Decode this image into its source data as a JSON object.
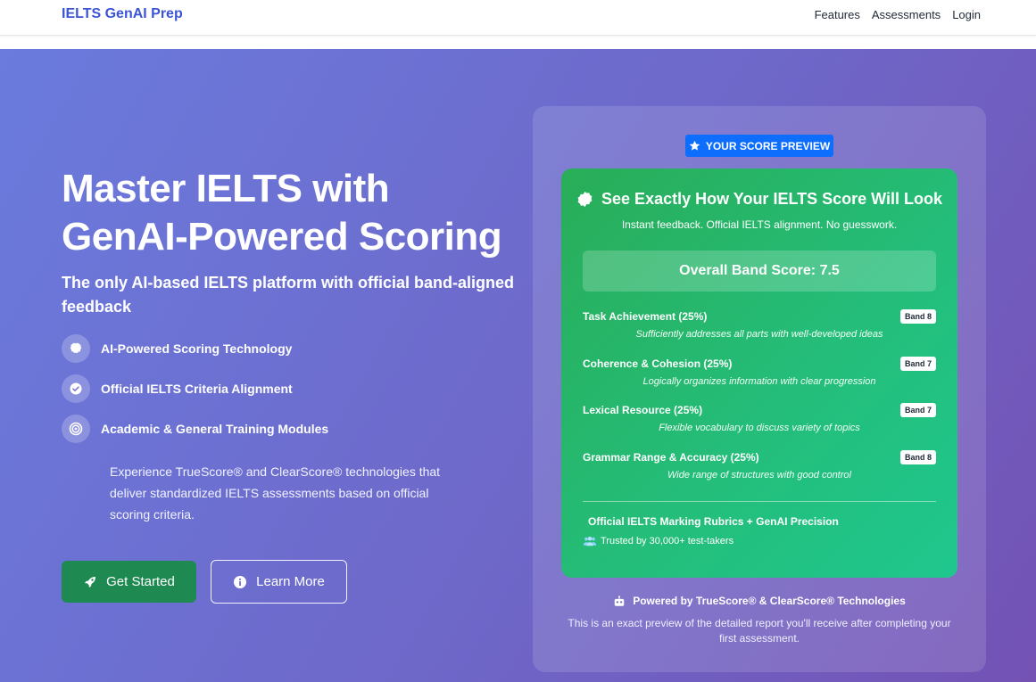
{
  "nav": {
    "brand": "IELTS GenAI Prep",
    "links": [
      "Features",
      "Assessments",
      "Login"
    ]
  },
  "hero": {
    "title": "Master IELTS with GenAI-Powered Scoring",
    "subtitle": "The only AI-based IELTS platform with official band-aligned feedback",
    "features": [
      {
        "icon": "brain-icon",
        "label": "AI-Powered Scoring Technology"
      },
      {
        "icon": "check-circle-icon",
        "label": "Official IELTS Criteria Alignment"
      },
      {
        "icon": "target-icon",
        "label": "Academic & General Training Modules"
      }
    ],
    "description": "Experience TrueScore® and ClearScore® technologies that deliver standardized IELTS assessments based on official scoring criteria.",
    "primary_button": "Get Started",
    "secondary_button": "Learn More"
  },
  "preview": {
    "badge": "YOUR SCORE PREVIEW",
    "card_title": "See Exactly How Your IELTS Score Will Look",
    "card_subtitle": "Instant feedback. Official IELTS alignment. No guesswork.",
    "overall": "Overall Band Score: 7.5",
    "criteria": [
      {
        "name": "Task Achievement (25%)",
        "band": "Band 8",
        "desc": "Sufficiently addresses all parts with well-developed ideas"
      },
      {
        "name": "Coherence & Cohesion (25%)",
        "band": "Band 7",
        "desc": "Logically organizes information with clear progression"
      },
      {
        "name": "Lexical Resource (25%)",
        "band": "Band 7",
        "desc": "Flexible vocabulary to discuss variety of topics"
      },
      {
        "name": "Grammar Range & Accuracy (25%)",
        "band": "Band 8",
        "desc": "Wide range of structures with good control"
      }
    ],
    "rubrics": "Official IELTS Marking Rubrics + GenAI Precision",
    "trusted": "Trusted by 30,000+ test-takers",
    "powered": "Powered by TrueScore® & ClearScore® Technologies",
    "note": "This is an exact preview of the detailed report you'll receive after completing your first assessment."
  },
  "colors": {
    "brand": "#3b55d6",
    "primary_button": "#1e8a52",
    "badge": "#0d6efd",
    "card_green": "#24bd79"
  }
}
